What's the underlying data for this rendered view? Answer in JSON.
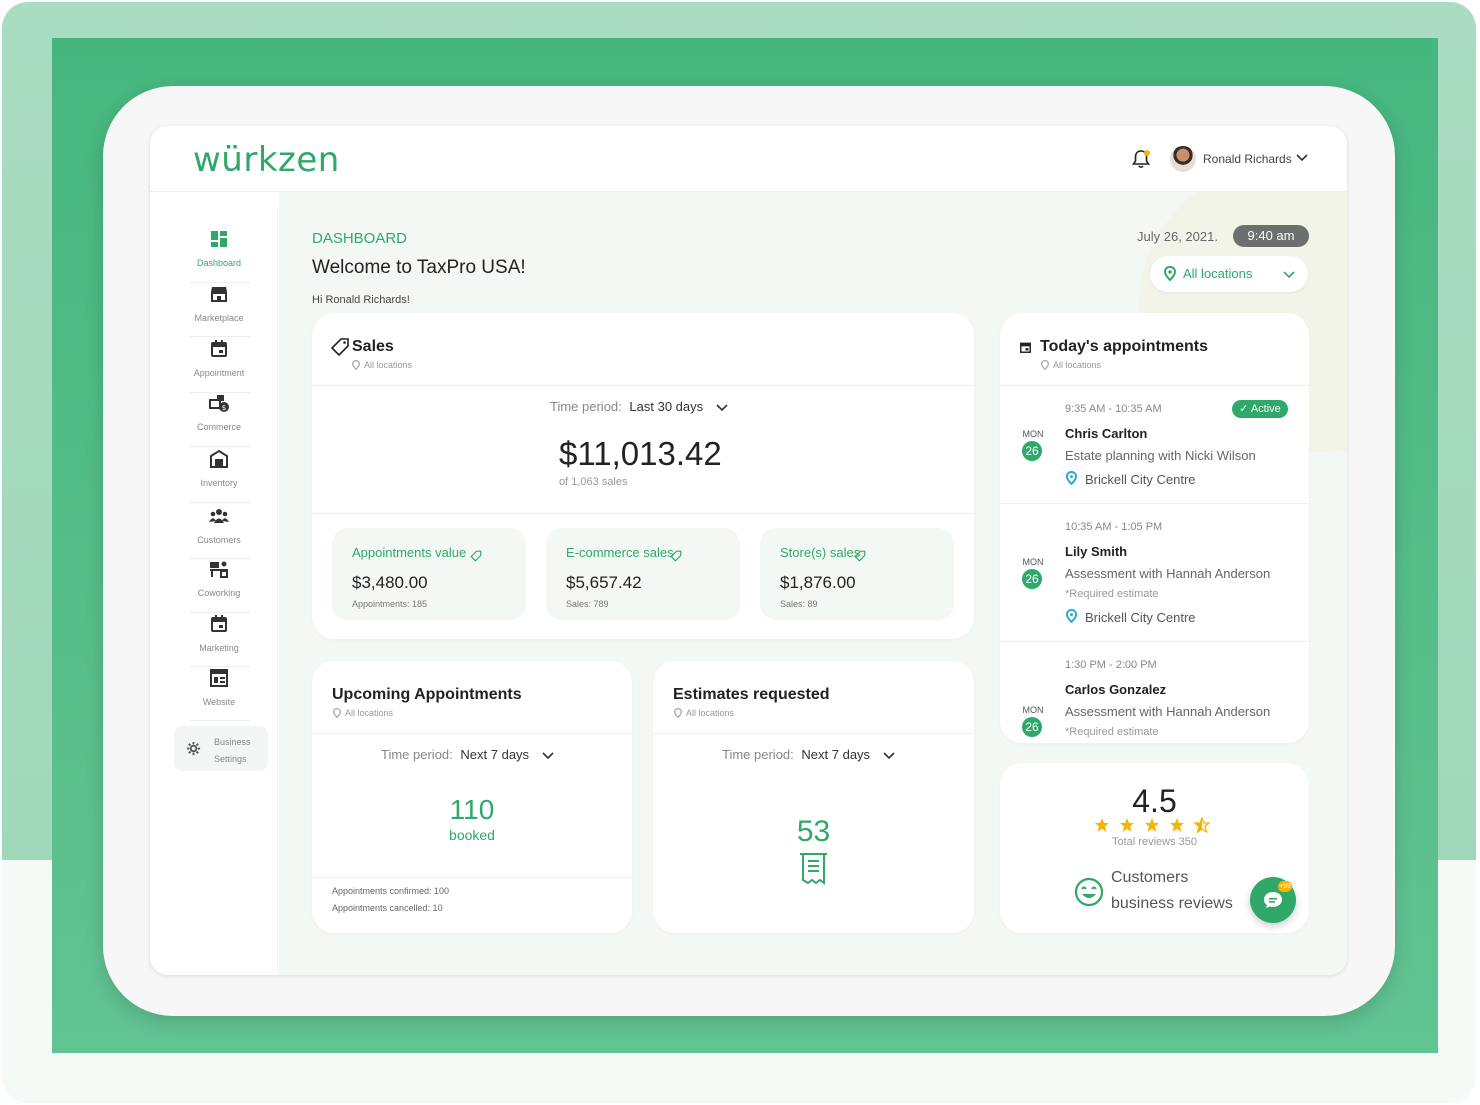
{
  "app": {
    "logo": "würkzen"
  },
  "user": {
    "name": "Ronald Richards"
  },
  "sidebar": {
    "items": [
      {
        "label": "Dashboard",
        "icon": "dashboard-icon"
      },
      {
        "label": "Marketplace",
        "icon": "store-icon"
      },
      {
        "label": "Appointment",
        "icon": "calendar-icon"
      },
      {
        "label": "Commerce",
        "icon": "commerce-icon"
      },
      {
        "label": "Inventory",
        "icon": "warehouse-icon"
      },
      {
        "label": "Customers",
        "icon": "people-icon"
      },
      {
        "label": "Coworking",
        "icon": "desk-icon"
      },
      {
        "label": "Marketing",
        "icon": "calendar-icon"
      },
      {
        "label": "Website",
        "icon": "website-icon"
      }
    ],
    "settings_line1": "Business",
    "settings_line2": "Settings"
  },
  "header": {
    "crumb": "DASHBOARD",
    "welcome": "Welcome to TaxPro USA!",
    "hi": "Hi Ronald Richards!",
    "date": "July 26, 2021.",
    "time": "9:40 am",
    "location": "All locations"
  },
  "sales": {
    "title": "Sales",
    "sub": "All locations",
    "period_label": "Time period:",
    "period_value": "Last 30 days",
    "total": "$11,013.42",
    "count": "of 1,063 sales",
    "tiles": [
      {
        "label": "Appointments value",
        "value": "$3,480.00",
        "note": "Appointments: 185"
      },
      {
        "label": "E-commerce sales",
        "value": "$5,657.42",
        "note": "Sales: 789"
      },
      {
        "label": "Store(s) sales",
        "value": "$1,876.00",
        "note": "Sales: 89"
      }
    ]
  },
  "upcoming": {
    "title": "Upcoming Appointments",
    "sub": "All locations",
    "period_label": "Time period:",
    "period_value": "Next 7 days",
    "count": "110",
    "count_label": "booked",
    "confirmed": "Appointments confirmed: 100",
    "cancelled": "Appointments cancelled: 10"
  },
  "estimates": {
    "title": "Estimates requested",
    "sub": "All locations",
    "period_label": "Time period:",
    "period_value": "Next 7 days",
    "count": "53"
  },
  "today": {
    "title": "Today's appointments",
    "sub": "All locations",
    "items": [
      {
        "time": "9:35 AM - 10:35 AM",
        "badge": "Active",
        "dow": "MON",
        "day": "26",
        "name": "Chris Carlton",
        "desc": "Estate planning with Nicki Wilson",
        "place": "Brickell City Centre"
      },
      {
        "time": "10:35 AM - 1:05 PM",
        "dow": "MON",
        "day": "26",
        "name": "Lily Smith",
        "desc": "Assessment with Hannah Anderson",
        "req": "*Required estimate",
        "place": "Brickell City Centre"
      },
      {
        "time": "1:30 PM - 2:00 PM",
        "dow": "MON",
        "day": "26",
        "name": "Carlos Gonzalez",
        "desc": "Assessment with Hannah Anderson",
        "req": "*Required estimate"
      }
    ]
  },
  "reviews": {
    "rating": "4.5",
    "stars": 4.5,
    "total": "Total reviews 350",
    "line1": "Customers",
    "line2": "business reviews",
    "chat_badge": "+99"
  },
  "colors": {
    "accent": "#2fa86a",
    "star": "#f4b400",
    "pin": "#29a9e0"
  }
}
